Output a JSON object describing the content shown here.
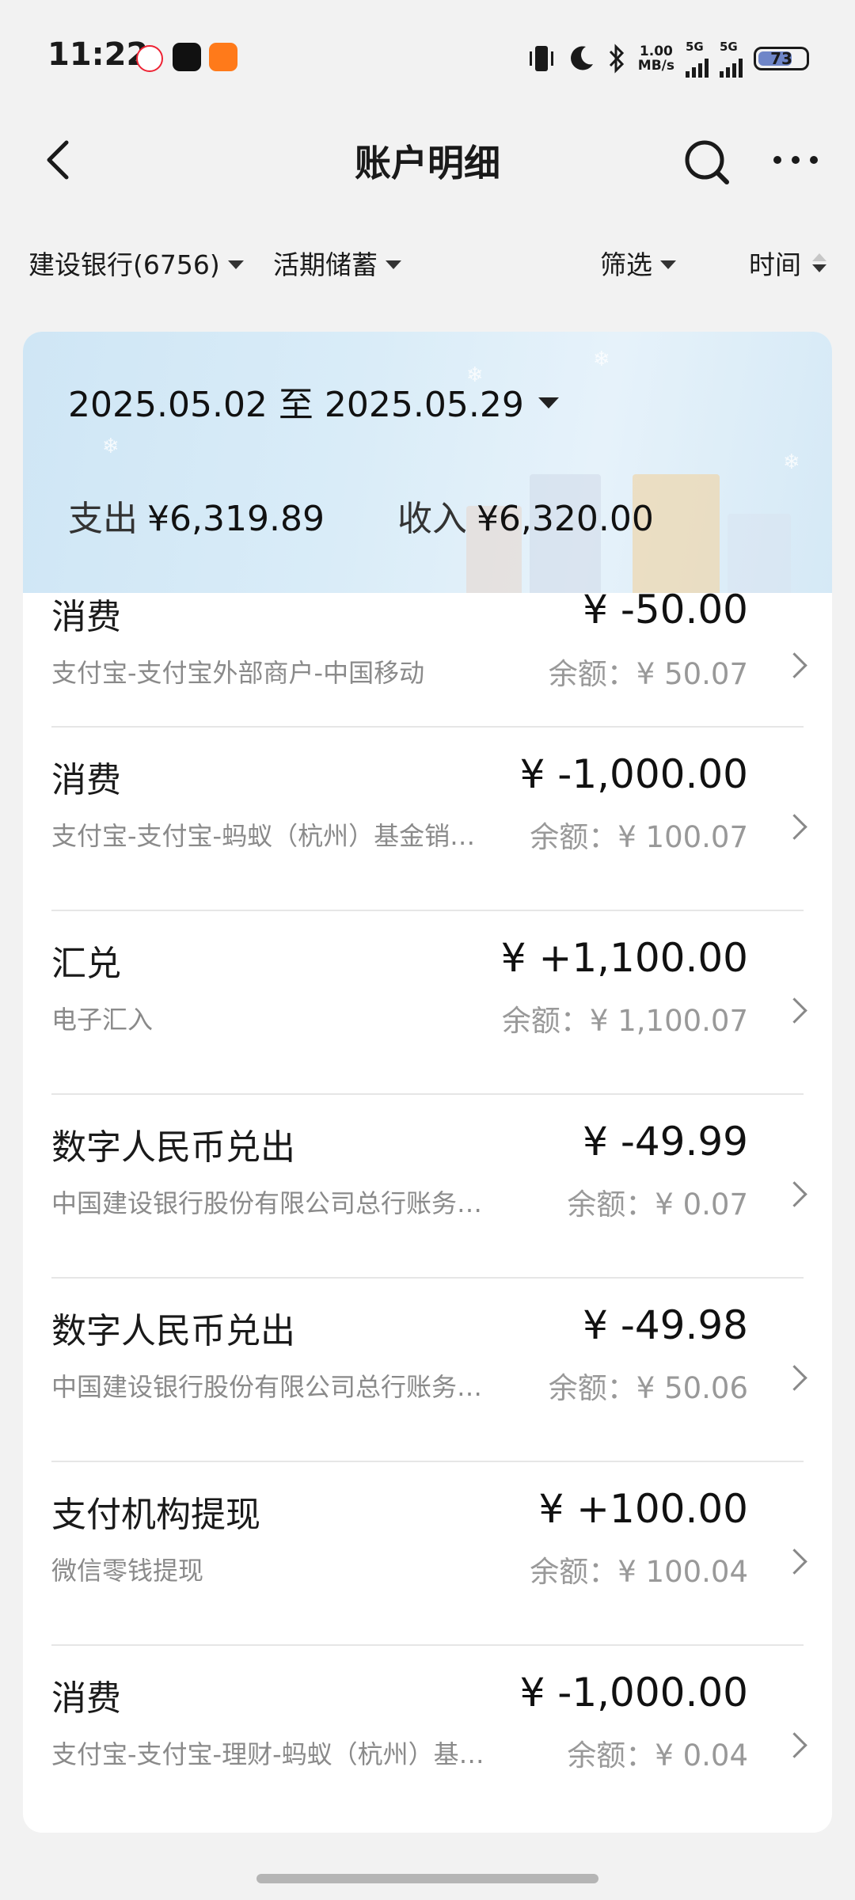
{
  "status_bar": {
    "time": "11:22",
    "net_speed_value": "1.00",
    "net_speed_unit": "MB/s",
    "sim1": "5G",
    "sim2": "5G",
    "battery": "73",
    "battery_fraction": 0.73
  },
  "header": {
    "title": "账户明细"
  },
  "filters": {
    "account": "建设银行(6756)",
    "account_type": "活期储蓄",
    "filter": "筛选",
    "sort": "时间"
  },
  "summary": {
    "date_range": "2025.05.02 至 2025.05.29",
    "expense_label": "支出",
    "expense_value": "¥6,319.89",
    "income_label": "收入",
    "income_value": "¥6,320.00"
  },
  "transactions": [
    {
      "type": "消费",
      "amount": "¥ -50.00",
      "desc": "支付宝-支付宝外部商户-中国移动",
      "balance": "余额：¥ 50.07"
    },
    {
      "type": "消费",
      "amount": "¥ -1,000.00",
      "desc": "支付宝-支付宝-蚂蚁（杭州）基金销…",
      "balance": "余额：¥ 100.07"
    },
    {
      "type": "汇兑",
      "amount": "¥ +1,100.00",
      "desc": "电子汇入",
      "balance": "余额：¥ 1,100.07"
    },
    {
      "type": "数字人民币兑出",
      "amount": "¥ -49.99",
      "desc": "中国建设银行股份有限公司总行账务…",
      "balance": "余额：¥ 0.07"
    },
    {
      "type": "数字人民币兑出",
      "amount": "¥ -49.98",
      "desc": "中国建设银行股份有限公司总行账务…",
      "balance": "余额：¥ 50.06"
    },
    {
      "type": "支付机构提现",
      "amount": "¥ +100.00",
      "desc": "微信零钱提现",
      "balance": "余额：¥ 100.04"
    },
    {
      "type": "消费",
      "amount": "¥ -1,000.00",
      "desc": "支付宝-支付宝-理财-蚂蚁（杭州）基…",
      "balance": "余额：¥ 0.04"
    }
  ]
}
